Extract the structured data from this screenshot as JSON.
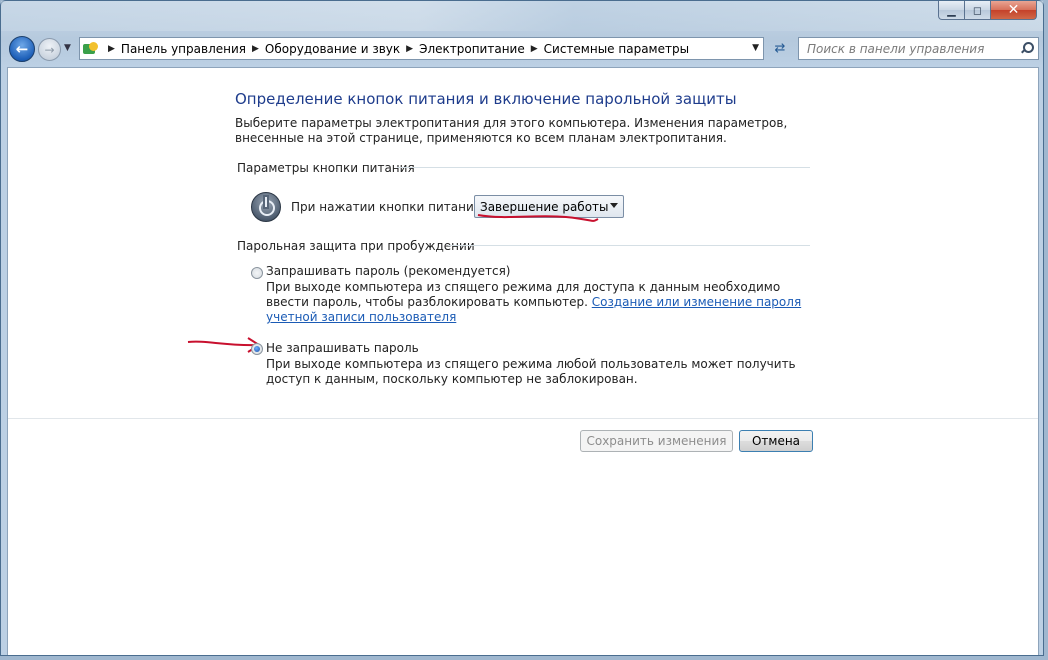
{
  "window": {
    "caption_buttons": {
      "minimize": "▁",
      "maximize": "◻",
      "close": "✕"
    }
  },
  "navigation": {
    "back_icon": "arrow-left-icon",
    "forward_icon": "arrow-right-icon",
    "breadcrumbs": [
      "Панель управления",
      "Оборудование и звук",
      "Электропитание",
      "Системные параметры"
    ],
    "search_placeholder": "Поиск в панели управления"
  },
  "main": {
    "title": "Определение кнопок питания и включение парольной защиты",
    "intro": "Выберите параметры электропитания для этого компьютера. Изменения параметров, внесенные на этой странице, применяются ко всем планам электропитания.",
    "power_section": {
      "header": "Параметры кнопки питания",
      "power_button_label": "При нажатии кнопки питания:",
      "power_button_value": "Завершение работы"
    },
    "password_section": {
      "header": "Парольная защита при пробуждении",
      "options": [
        {
          "label": "Запрашивать пароль (рекомендуется)",
          "checked": false,
          "description": "При выходе компьютера из спящего режима для доступа к данным необходимо ввести пароль, чтобы разблокировать компьютер.",
          "link": "Создание или изменение пароля учетной записи пользователя"
        },
        {
          "label": "Не запрашивать пароль",
          "checked": true,
          "description": "При выходе компьютера из спящего режима любой пользователь может получить доступ к данным, поскольку компьютер не заблокирован."
        }
      ]
    },
    "buttons": {
      "save": "Сохранить изменения",
      "cancel": "Отмена"
    }
  },
  "colors": {
    "title_blue": "#1e3c8c",
    "link_blue": "#1b5bb5",
    "annotation_red": "#c8102e"
  }
}
